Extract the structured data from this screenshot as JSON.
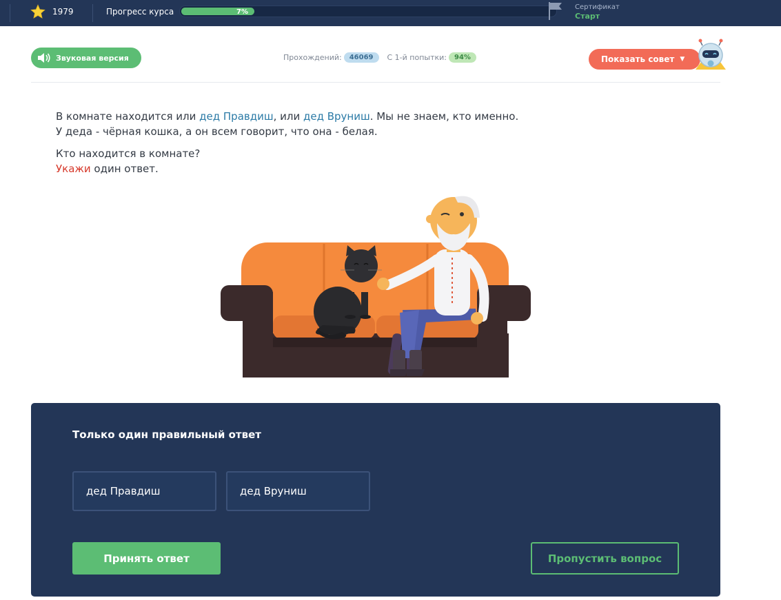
{
  "topbar": {
    "score": "1979",
    "progress_label": "Прогресс курса",
    "progress_value": 0.07,
    "progress_text": "7%",
    "certificate_label": "Сертификат",
    "certificate_value": "Старт"
  },
  "controls": {
    "sound_label": "Звуковая версия",
    "attempts_label": "Прохождений:",
    "attempts_value": "46069",
    "first_try_label": "С 1-й попытки:",
    "first_try_value": "94%",
    "hint_label": "Показать совет"
  },
  "question": {
    "line1_a": "В комнате находится или ",
    "line1_name1": "дед Правдиш",
    "line1_b": ", или ",
    "line1_name2": "дед Вруниш",
    "line1_c": ". Мы не знаем, кто именно.",
    "line2": "У деда - чёрная кошка, а он всем говорит, что она - белая.",
    "line3": "Кто находится в комнате?",
    "line4_accent": "Укажи",
    "line4_rest": " один ответ."
  },
  "answers": {
    "title": "Только один правильный ответ",
    "options": [
      "дед Правдиш",
      "дед Вруниш"
    ],
    "submit_label": "Принять ответ",
    "skip_label": "Пропустить вопрос"
  },
  "colors": {
    "topbar": "#233657",
    "accent_green": "#5cbd74",
    "hint_orange": "#f26b57",
    "link_blue": "#2b7aa6",
    "accent_red": "#d6382a"
  },
  "icons": [
    "star-icon",
    "flag-icon",
    "speaker-icon",
    "caret-down-icon",
    "robot-icon"
  ]
}
